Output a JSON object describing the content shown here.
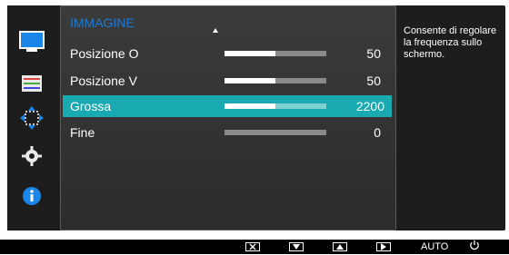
{
  "osd": {
    "menu_title": "IMMAGINE",
    "rows": [
      {
        "label": "Posizione O",
        "value": "50",
        "fill": 0.5
      },
      {
        "label": "Posizione V",
        "value": "50",
        "fill": 0.5
      },
      {
        "label": "Grossa",
        "value": "2200",
        "fill": 0.5
      },
      {
        "label": "Fine",
        "value": "0",
        "fill": 0.0
      }
    ],
    "help_text": "Consente di regolare la frequenza sullo schermo."
  },
  "sidebar": {
    "icons": [
      "monitor-icon",
      "color-bars-icon",
      "screen-size-arrows-icon",
      "gear-icon",
      "info-icon"
    ]
  },
  "bottom_bar": {
    "buttons": [
      "close-x-icon",
      "down-triangle-icon",
      "up-triangle-icon",
      "right-triangle-icon"
    ],
    "auto_label": "AUTO",
    "power_icon": "power-icon"
  },
  "colors": {
    "accent_blue": "#1e7ad6",
    "selection_teal": "#18aab0"
  }
}
